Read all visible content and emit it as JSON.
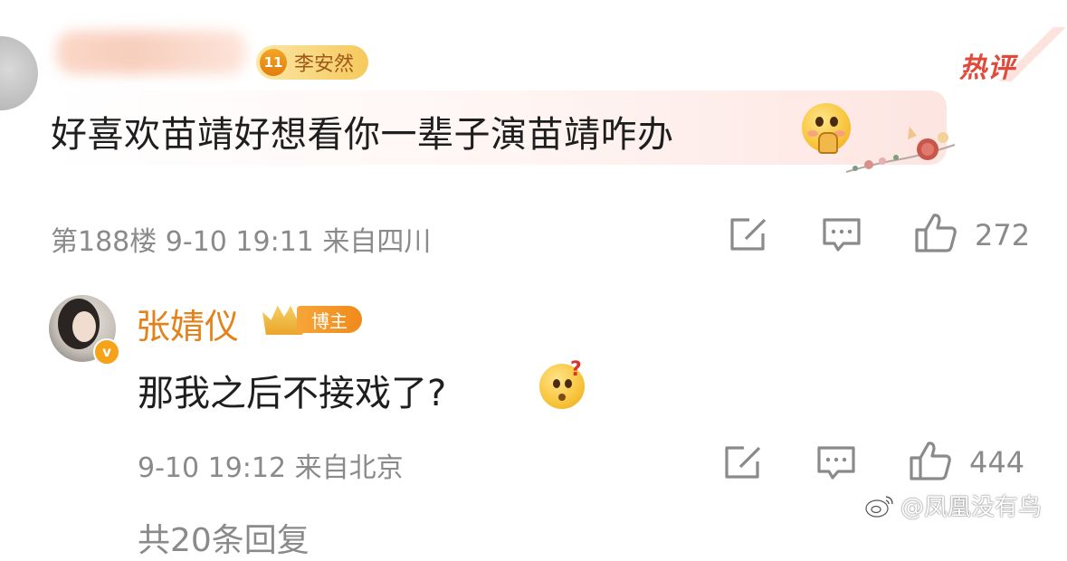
{
  "comment1": {
    "fan_badge_level": "11",
    "fan_badge_name": "李安然",
    "hot_label": "热评",
    "text": "好喜欢苗靖好想看你一辈子演苗靖咋办",
    "emoji": "pleading-hands-emoji",
    "meta": "第188楼 9-10 19:11 来自四川",
    "like_count": "272"
  },
  "comment2": {
    "username": "张婧仪",
    "blogger_badge": "博主",
    "verify_mark": "v",
    "text": "那我之后不接戏了?",
    "emoji": "confused-emoji",
    "meta": "9-10 19:12 来自北京",
    "like_count": "444"
  },
  "more_replies": "共20条回复",
  "watermark": "@凤凰没有鸟",
  "colors": {
    "username": "#e4821a",
    "hot": "#e2493b",
    "meta": "#8a8a8a",
    "badge_orange": "#f08a1a"
  },
  "icons": [
    "share-icon",
    "comment-icon",
    "like-icon"
  ]
}
